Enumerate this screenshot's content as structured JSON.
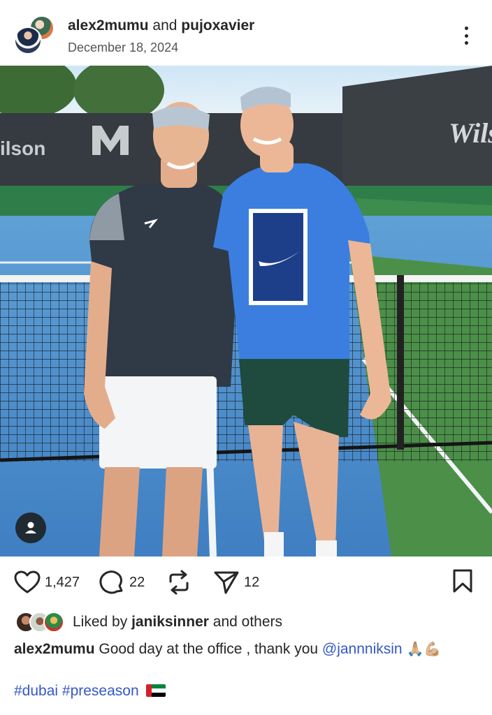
{
  "post": {
    "author": "alex2mumu",
    "joiner": "and",
    "coauthor": "pujoxavier",
    "date": "December 18, 2024"
  },
  "photo": {
    "banner_left": "ilson",
    "banner_right": "Wils"
  },
  "actions": {
    "likes": "1,427",
    "comments": "22",
    "shares": "12"
  },
  "liked_by": {
    "prefix": "Liked by ",
    "user": "janiksinner",
    "suffix": " and others"
  },
  "caption": {
    "user": "alex2mumu",
    "text": " Good day at the office , thank you ",
    "mention": "@jannniksin",
    "emojis": "🙏🏼💪🏼"
  },
  "hashtags": {
    "tag1": "#dubai",
    "tag2": "#preseason"
  }
}
